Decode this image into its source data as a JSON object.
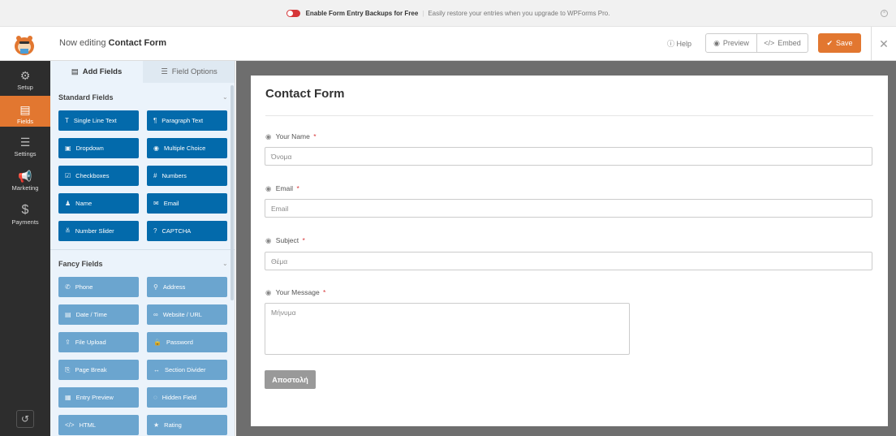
{
  "notice": {
    "title": "Enable Form Entry Backups for Free",
    "text": "Easily restore your entries when you upgrade to WPForms Pro."
  },
  "header": {
    "editing_prefix": "Now editing",
    "form_name": "Contact Form",
    "help_label": "Help",
    "preview_label": "Preview",
    "embed_label": "Embed",
    "save_label": "Save"
  },
  "sidenav": {
    "items": [
      {
        "label": "Setup",
        "icon": "gear-icon"
      },
      {
        "label": "Fields",
        "icon": "fields-icon",
        "active": true
      },
      {
        "label": "Settings",
        "icon": "sliders-icon"
      },
      {
        "label": "Marketing",
        "icon": "megaphone-icon"
      },
      {
        "label": "Payments",
        "icon": "dollar-icon"
      }
    ]
  },
  "panel": {
    "tabs": [
      {
        "label": "Add Fields",
        "active": true
      },
      {
        "label": "Field Options",
        "active": false
      }
    ],
    "standard_title": "Standard Fields",
    "standard_fields": [
      {
        "label": "Single Line Text",
        "icon": "T"
      },
      {
        "label": "Paragraph Text",
        "icon": "¶"
      },
      {
        "label": "Dropdown",
        "icon": "▣"
      },
      {
        "label": "Multiple Choice",
        "icon": "◉"
      },
      {
        "label": "Checkboxes",
        "icon": "☑"
      },
      {
        "label": "Numbers",
        "icon": "#"
      },
      {
        "label": "Name",
        "icon": "♟"
      },
      {
        "label": "Email",
        "icon": "✉"
      },
      {
        "label": "Number Slider",
        "icon": "≚"
      },
      {
        "label": "CAPTCHA",
        "icon": "?"
      }
    ],
    "fancy_title": "Fancy Fields",
    "fancy_fields": [
      {
        "label": "Phone",
        "icon": "✆"
      },
      {
        "label": "Address",
        "icon": "⚲"
      },
      {
        "label": "Date / Time",
        "icon": "▤"
      },
      {
        "label": "Website / URL",
        "icon": "∞"
      },
      {
        "label": "File Upload",
        "icon": "⇪"
      },
      {
        "label": "Password",
        "icon": "🔒"
      },
      {
        "label": "Page Break",
        "icon": "⎘"
      },
      {
        "label": "Section Divider",
        "icon": "↔"
      },
      {
        "label": "Entry Preview",
        "icon": "▦"
      },
      {
        "label": "Hidden Field",
        "icon": "◌"
      },
      {
        "label": "HTML",
        "icon": "</>"
      },
      {
        "label": "Rating",
        "icon": "★"
      }
    ]
  },
  "form": {
    "title": "Contact Form",
    "fields": [
      {
        "label": "Your Name",
        "placeholder": "Όνομα"
      },
      {
        "label": "Email",
        "placeholder": "Email"
      },
      {
        "label": "Subject",
        "placeholder": "Θέμα"
      },
      {
        "label": "Your Message",
        "placeholder": "Μήνυμα"
      }
    ],
    "required_mark": "*",
    "submit_label": "Αποστολή"
  },
  "colors": {
    "accent": "#e27730",
    "standard_button": "#036aab",
    "fancy_button": "#6ba5cf",
    "sidebar": "#2d2d2d"
  }
}
